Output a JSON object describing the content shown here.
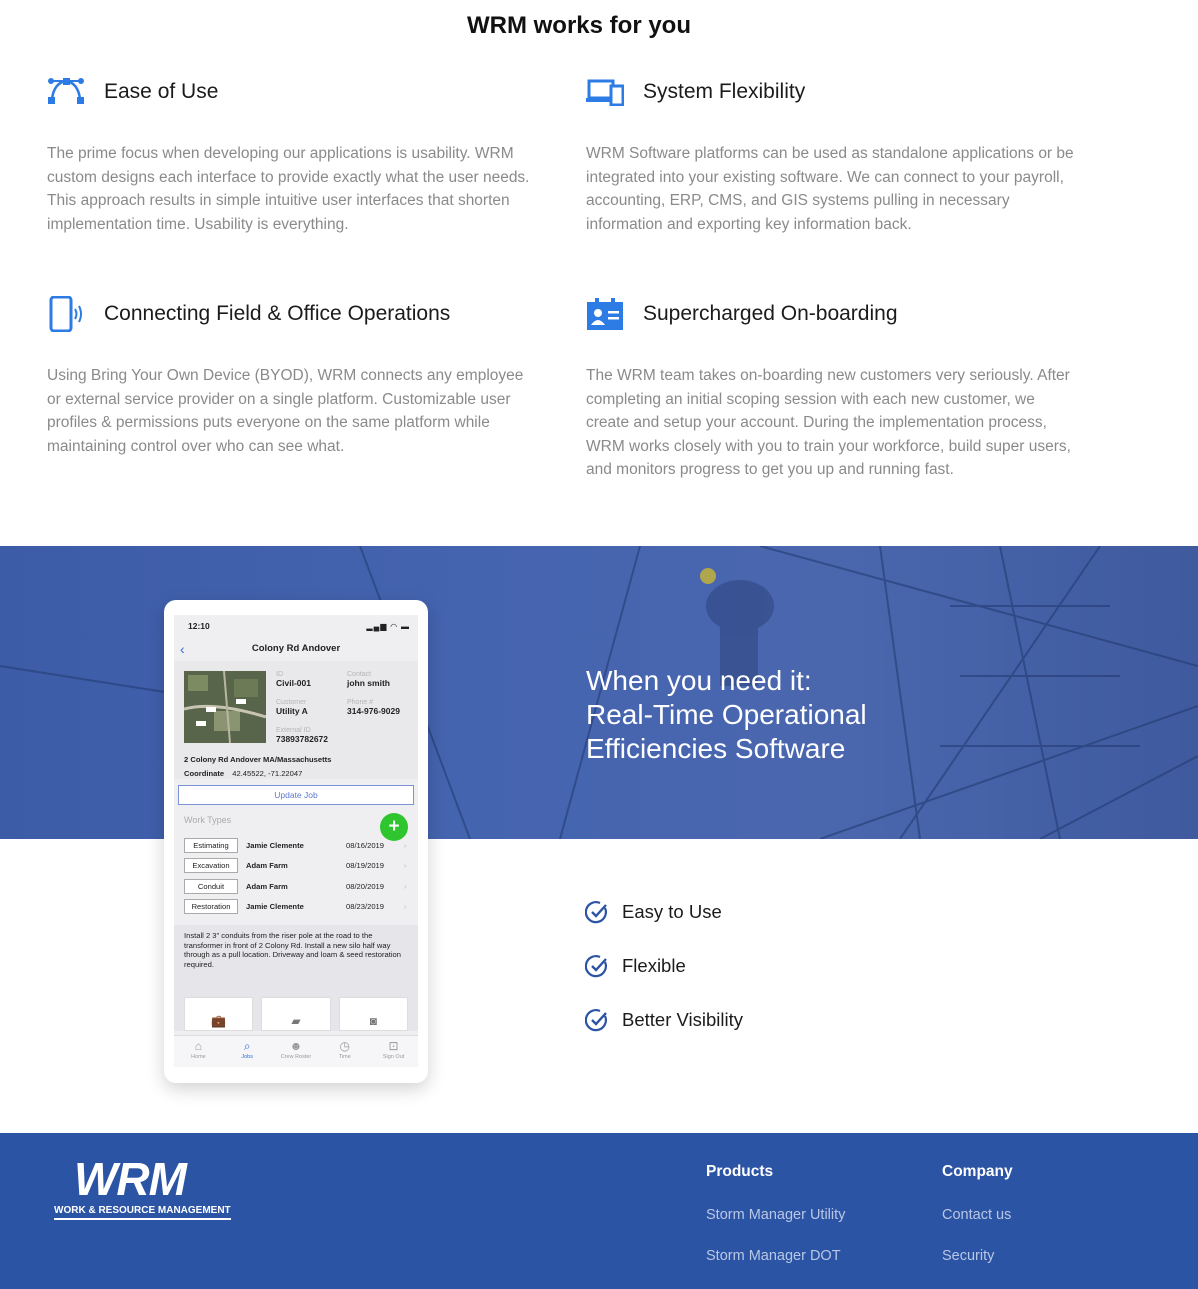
{
  "section": {
    "title": "WRM works for you"
  },
  "features": [
    {
      "title": "Ease of Use",
      "icon": "vector-nodes-icon",
      "text": "The prime focus when developing our applications is usability. WRM custom designs each interface to provide exactly what the user needs. This approach results in simple intuitive user interfaces that shorten implementation time. Usability is everything."
    },
    {
      "title": "System Flexibility",
      "icon": "devices-icon",
      "text": "WRM Software platforms can be used as standalone applications or be integrated into your existing software. We can connect to your payroll, accounting, ERP, CMS, and GIS systems pulling in necessary information and exporting key information back."
    },
    {
      "title": "Connecting Field & Office Operations",
      "icon": "mobile-signal-icon",
      "text": "Using Bring Your Own Device (BYOD), WRM connects any employee or external service provider on a single platform. Customizable user profiles & permissions puts everyone on the same platform while maintaining control over who can see what."
    },
    {
      "title": "Supercharged On-boarding",
      "icon": "id-card-icon",
      "text": "The WRM team takes on-boarding new customers very seriously. After completing an initial scoping session with each new customer, we create and setup your account. During the implementation process, WRM works closely with you to train your workforce, build super users, and monitors progress to get you up and running fast."
    }
  ],
  "banner": {
    "line1": "When you need it:",
    "line2": "Real-Time Operational",
    "line3": "Efficiencies Software"
  },
  "benefits": [
    "Easy to Use",
    "Flexible",
    "Better Visibility"
  ],
  "phone": {
    "time": "12:10",
    "title": "Colony Rd Andover",
    "id_label": "ID",
    "id": "Civil-001",
    "contact_label": "Contact",
    "contact": "john smith",
    "customer_label": "Customer",
    "customer": "Utility A",
    "phone_label": "Phone #",
    "phone": "314-976-9029",
    "external_label": "External ID",
    "external": "73893782672",
    "address": "2 Colony Rd Andover MA/Massachusetts",
    "coord_label": "Coordinate",
    "coord": "42.45522, -71.22047",
    "update_button": "Update Job",
    "work_types_label": "Work Types",
    "work_types": [
      {
        "type": "Estimating",
        "name": "Jamie Clemente",
        "date": "08/16/2019"
      },
      {
        "type": "Excavation",
        "name": "Adam Farm",
        "date": "08/19/2019"
      },
      {
        "type": "Conduit",
        "name": "Adam Farm",
        "date": "08/20/2019"
      },
      {
        "type": "Restoration",
        "name": "Jamie Clemente",
        "date": "08/23/2019"
      }
    ],
    "notes": "Install 2 3\" conduits from the riser pole at the road to the transformer in front of 2 Colony Rd. Install a new silo half way through as a pull location. Driveway and loam & seed restoration required.",
    "tabs": [
      "Home",
      "Jobs",
      "Crew Roster",
      "Time",
      "Sign Out"
    ]
  },
  "footer": {
    "logo_text": "WRM",
    "logo_sub": "WORK & RESOURCE MANAGEMENT",
    "products_heading": "Products",
    "products": [
      "Storm Manager Utility",
      "Storm Manager DOT"
    ],
    "company_heading": "Company",
    "company": [
      "Contact us",
      "Security"
    ]
  },
  "colors": {
    "accent": "#2d7be5",
    "banner": "#4564b0",
    "footer": "#2c54a4",
    "check": "#2c54a4"
  }
}
